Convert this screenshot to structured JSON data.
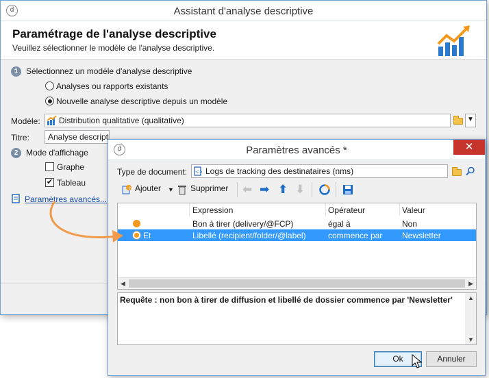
{
  "main_window": {
    "title": "Assistant d'analyse descriptive",
    "heading": "Paramétrage de l'analyse descriptive",
    "subheading": "Veuillez sélectionner le modèle de l'analyse descriptive.",
    "step1": {
      "num": "1",
      "label": "Sélectionnez un modèle d'analyse descriptive",
      "options": [
        {
          "label": "Analyses ou rapports existants",
          "selected": false
        },
        {
          "label": "Nouvelle analyse descriptive depuis un modèle",
          "selected": true
        }
      ]
    },
    "model": {
      "label": "Modèle:",
      "value": "Distribution qualitative (qualitative)"
    },
    "title_field": {
      "label": "Titre:",
      "value": "Analyse descriptive"
    },
    "step2": {
      "num": "2",
      "label": "Mode d'affichage",
      "options": [
        {
          "label": "Graphe",
          "checked": false
        },
        {
          "label": "Tableau",
          "checked": true
        }
      ]
    },
    "advanced_link": "Paramètres avancés..."
  },
  "advanced_dialog": {
    "title": "Paramètres avancés *",
    "doc_type": {
      "label": "Type de document:",
      "value": "Logs de tracking des destinataires (nms)"
    },
    "toolbar": {
      "add": "Ajouter",
      "delete": "Supprimer"
    },
    "columns": [
      "Expression",
      "Opérateur",
      "Valeur"
    ],
    "rows": [
      {
        "prefix": "",
        "expression": "Bon à tirer (delivery/@FCP)",
        "operator": "égal à",
        "value": "Non",
        "selected": false
      },
      {
        "prefix": "Et",
        "expression": "Libellé (recipient/folder/@label)",
        "operator": "commence par",
        "value": "Newsletter",
        "selected": true
      }
    ],
    "query": "Requête : non bon à tirer de diffusion et libellé de dossier commence par 'Newsletter'",
    "ok": "Ok",
    "cancel": "Annuler"
  },
  "colors": {
    "accent": "#3399ff",
    "close": "#c7342b",
    "link": "#1a4fa3",
    "arrow": "#f09a4a"
  }
}
